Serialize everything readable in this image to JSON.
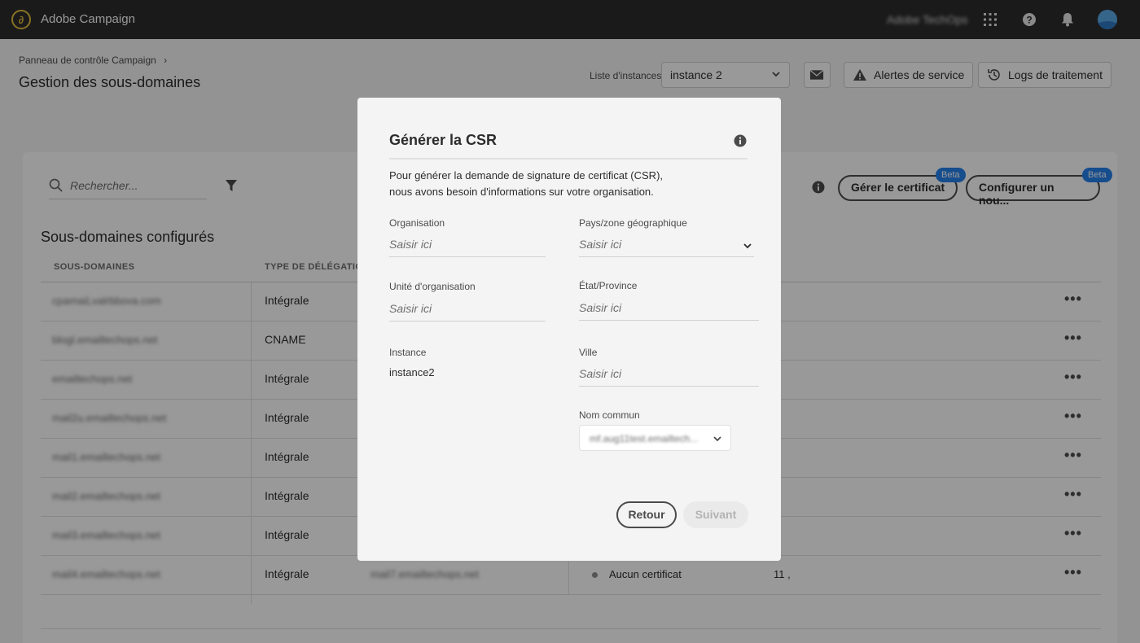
{
  "topbar": {
    "app_title": "Adobe Campaign",
    "org_name": "Adobe TechOps",
    "icons": [
      "apps-grid-icon",
      "help-icon",
      "bell-icon",
      "avatar"
    ]
  },
  "header": {
    "breadcrumb": "Panneau de contrôle Campaign",
    "title": "Gestion des sous-domaines",
    "instance_label": "Liste d'instances",
    "instance_value": "instance 2",
    "alerts_label": "Alertes de service",
    "logs_label": "Logs de traitement"
  },
  "toolbar": {
    "search_placeholder": "Rechercher...",
    "manage_cert_label": "Gérer le certificat",
    "configure_label": "Configurer un nou...",
    "beta_label": "Beta"
  },
  "table": {
    "section_title": "Sous-domaines configurés",
    "columns": [
      "SOUS-DOMAINES",
      "TYPE DE DÉLÉGATION"
    ],
    "rows": [
      {
        "subdomain": "cpamaiLvalrbbova.com",
        "type": "Intégrale"
      },
      {
        "subdomain": "blogl.emailtechops.net",
        "type": "CNAME"
      },
      {
        "subdomain": "emailtechops.net",
        "type": "Intégrale"
      },
      {
        "subdomain": "mail2u.emailtechops.net",
        "type": "Intégrale"
      },
      {
        "subdomain": "mail1.emailtechops.net",
        "type": "Intégrale"
      },
      {
        "subdomain": "mail2.emailtechops.net",
        "type": "Intégrale"
      },
      {
        "subdomain": "mail3.emailtechops.net",
        "type": "Intégrale"
      },
      {
        "subdomain": "mail4.emailtechops.net",
        "type": "Intégrale"
      }
    ],
    "last_row_extra": {
      "sub": "mail7.emailtechops.net",
      "status": "Aucun certificat",
      "num": "11 ,"
    }
  },
  "dialog": {
    "title": "Générer la CSR",
    "description_line1": "Pour générer la demande de signature de certificat (CSR),",
    "description_line2": "nous avons besoin d'informations sur votre organisation.",
    "fields": {
      "organisation": {
        "label": "Organisation",
        "placeholder": "Saisir ici"
      },
      "country": {
        "label": "Pays/zone géographique",
        "placeholder": "Saisir ici"
      },
      "org_unit": {
        "label": "Unité d'organisation",
        "placeholder": "Saisir ici"
      },
      "state": {
        "label": "État/Province",
        "placeholder": "Saisir ici"
      },
      "instance": {
        "label": "Instance",
        "value": "instance2"
      },
      "city": {
        "label": "Ville",
        "placeholder": "Saisir ici"
      },
      "common_name": {
        "label": "Nom commun",
        "value": "mf.aug11test.emailtech..."
      }
    },
    "back_label": "Retour",
    "next_label": "Suivant"
  }
}
